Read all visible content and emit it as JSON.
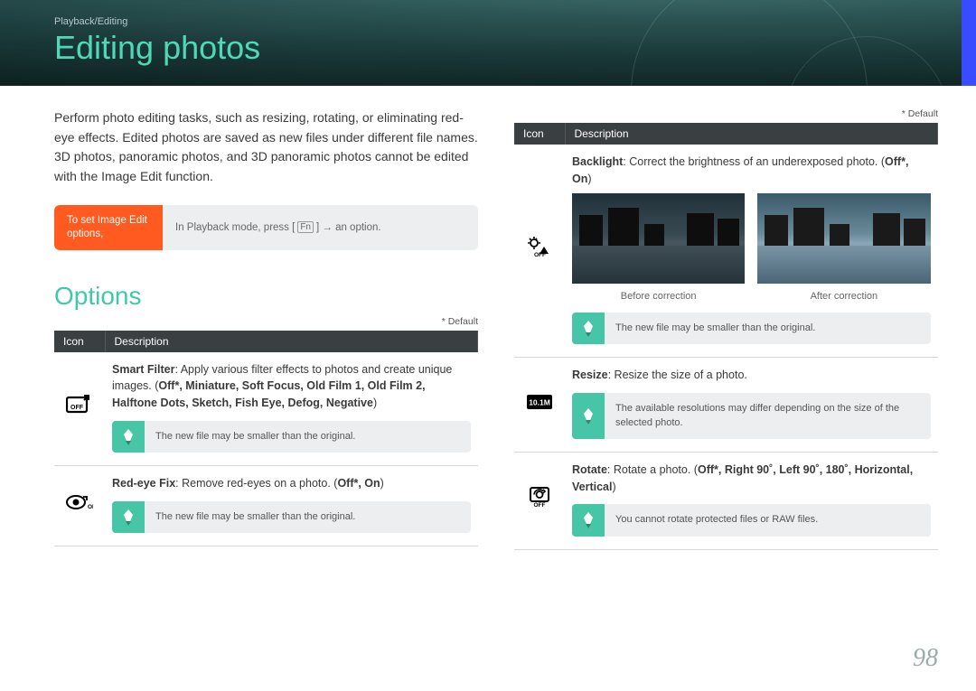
{
  "breadcrumb": "Playback/Editing",
  "page_title": "Editing photos",
  "intro": "Perform photo editing tasks, such as resizing, rotating, or eliminating red-eye effects. Edited photos are saved as new files under different file names. 3D photos, panoramic photos, and 3D panoramic photos cannot be edited with the Image Edit function.",
  "instruction": {
    "label": "To set Image Edit options,",
    "pre": "In Playback mode, press [",
    "key": "Fn",
    "post": "] → an option."
  },
  "section_title": "Options",
  "default_note": "* Default",
  "table_headers": {
    "icon": "Icon",
    "desc": "Description"
  },
  "left_rows": {
    "smart_filter": {
      "label": "Smart Filter",
      "text": ": Apply various filter effects to photos and create unique images. (",
      "opts": "Off*, Miniature, Soft Focus, Old Film 1, Old Film 2, Halftone Dots, Sketch, Fish Eye, Defog, Negative",
      "close": ")",
      "note": "The new file may be smaller than the original."
    },
    "redeye": {
      "label": "Red-eye Fix",
      "text": ": Remove red-eyes on a photo. (",
      "opts": "Off*, On",
      "close": ")",
      "note": "The new file may be smaller than the original."
    }
  },
  "right_rows": {
    "backlight": {
      "label": "Backlight",
      "text": ": Correct the brightness of an underexposed photo. (",
      "opts": "Off*, On",
      "close": ")",
      "before": "Before correction",
      "after": "After correction",
      "note": "The new file may be smaller than the original."
    },
    "resize": {
      "label": "Resize",
      "text": ": Resize the size of a photo.",
      "note": "The available resolutions may differ depending on the size of the selected photo."
    },
    "rotate": {
      "label": "Rotate",
      "text": ": Rotate a photo. (",
      "opts": "Off*, Right 90˚, Left 90˚, 180˚, Horizontal, Vertical",
      "close": ")",
      "note": "You cannot rotate protected files or RAW files."
    }
  },
  "page_number": "98"
}
